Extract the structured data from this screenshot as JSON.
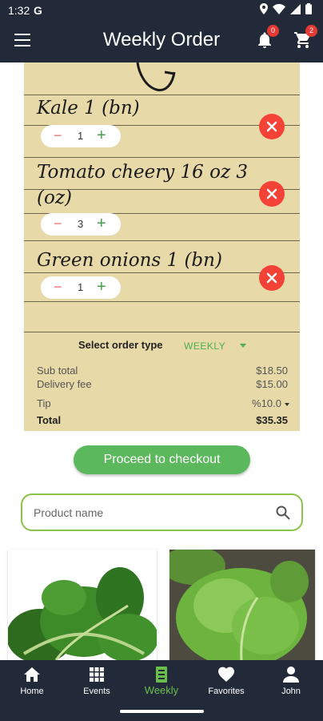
{
  "status": {
    "time": "1:32",
    "carrier_icon": "G"
  },
  "app_bar": {
    "title": "Weekly Order",
    "notification_count": "0",
    "cart_count": "2"
  },
  "order_items": [
    {
      "name": "Kale 1 (bn)",
      "qty": "1"
    },
    {
      "name": "Tomato cheery   16 oz 3",
      "name_line2": "(oz)",
      "qty": "3"
    },
    {
      "name": "Green onions 1 (bn)",
      "qty": "1"
    }
  ],
  "stepper": {
    "minus": "−",
    "plus": "+"
  },
  "order_type": {
    "label": "Select order type",
    "value": "WEEKLY"
  },
  "summary": {
    "subtotal_label": "Sub total",
    "subtotal_value": "$18.50",
    "delivery_label": "Delivery fee",
    "delivery_value": "$15.00",
    "tip_label": "Tip",
    "tip_value": "%10.0",
    "total_label": "Total",
    "total_value": "$35.35"
  },
  "checkout_label": "Proceed to checkout",
  "search": {
    "placeholder": "Product name"
  },
  "bottom_nav": [
    {
      "label": "Home",
      "icon": "home-icon"
    },
    {
      "label": "Events",
      "icon": "grid-icon"
    },
    {
      "label": "Weekly",
      "icon": "document-icon"
    },
    {
      "label": "Favorites",
      "icon": "heart-icon"
    },
    {
      "label": "John",
      "icon": "person-icon"
    }
  ],
  "colors": {
    "bar": "#222a3a",
    "accent": "#5cb85c",
    "paper": "#e8d9a8",
    "remove": "#f44336"
  }
}
